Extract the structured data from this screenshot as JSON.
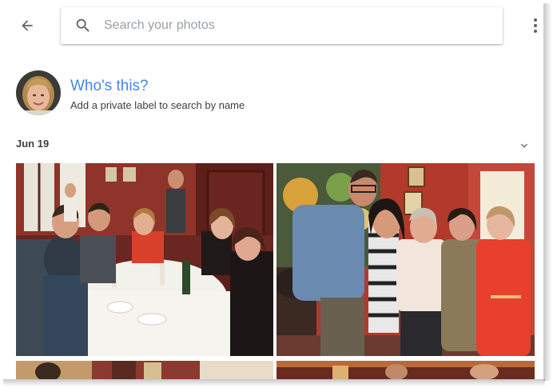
{
  "toolbar": {
    "back_icon": "arrow-back-icon",
    "more_icon": "more-vert-icon"
  },
  "search": {
    "icon": "search-icon",
    "placeholder": "Search your photos",
    "value": ""
  },
  "face_prompt": {
    "title": "Who's this?",
    "subtitle": "Add a private label to search by name",
    "title_color": "#4285f4"
  },
  "section": {
    "date": "Jun 19",
    "collapse_icon": "chevron-down-icon"
  },
  "photos": [
    {
      "description_name": "restaurant-group-photo"
    },
    {
      "description_name": "family-standing-photo"
    },
    {
      "description_name": "partial-photo-1"
    },
    {
      "description_name": "partial-photo-2"
    }
  ]
}
